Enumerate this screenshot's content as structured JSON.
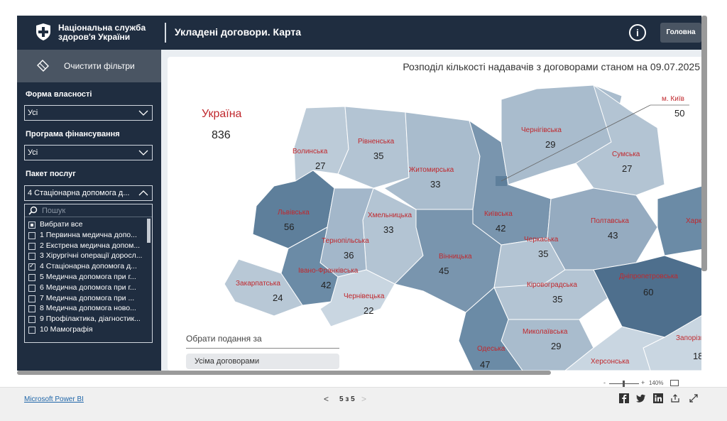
{
  "header": {
    "org_name_line1": "Національна служба",
    "org_name_line2": "здоров'я України",
    "title": "Укладені договори. Карта",
    "info_label": "i",
    "home_label": "Головна"
  },
  "sidebar": {
    "clear_filters": "Очистити фільтри",
    "ownership_label": "Форма власності",
    "ownership_value": "Усі",
    "program_label": "Програма фінансування",
    "program_value": "Усі",
    "package_label": "Пакет послуг",
    "package_value": "4 Стаціонарна допомога д...",
    "search_placeholder": "Пошук",
    "options": [
      {
        "label": "Вибрати все",
        "state": "partial"
      },
      {
        "label": "1 Первинна медична допо...",
        "state": "off"
      },
      {
        "label": "2 Екстрена медична допом...",
        "state": "off"
      },
      {
        "label": "3 Хірургічні операції доросл...",
        "state": "off"
      },
      {
        "label": "4 Стаціонарна допомога д...",
        "state": "on"
      },
      {
        "label": "5 Медична допомога при г...",
        "state": "off"
      },
      {
        "label": "6 Медична допомога при г...",
        "state": "off"
      },
      {
        "label": "7 Медична допомога при ...",
        "state": "off"
      },
      {
        "label": "8 Медична допомога ново...",
        "state": "off"
      },
      {
        "label": "9 Профілактика, діагностик...",
        "state": "off"
      },
      {
        "label": "10 Мамографія",
        "state": "off"
      }
    ]
  },
  "map": {
    "title": "Розподіл кількості надавачів з договорами станом на 09.07.2025",
    "country_label": "Україна",
    "country_value": "836",
    "kyiv_label": "м. Київ",
    "kyiv_value": "50",
    "regions": [
      {
        "name": "Волинська",
        "value": "27"
      },
      {
        "name": "Рівненська",
        "value": "35"
      },
      {
        "name": "Житомирська",
        "value": "33"
      },
      {
        "name": "Чернігівська",
        "value": "29"
      },
      {
        "name": "Сумська",
        "value": "27"
      },
      {
        "name": "Львівська",
        "value": "56"
      },
      {
        "name": "Хмельницька",
        "value": "33"
      },
      {
        "name": "Київська",
        "value": "42"
      },
      {
        "name": "Полтавська",
        "value": "43"
      },
      {
        "name": "Харк",
        "value": ""
      },
      {
        "name": "Тернопільська",
        "value": "36"
      },
      {
        "name": "Черкаська",
        "value": "35"
      },
      {
        "name": "Вінницька",
        "value": "45"
      },
      {
        "name": "Івано-Франківська",
        "value": "42"
      },
      {
        "name": "Закарпатська",
        "value": "24"
      },
      {
        "name": "Чернівецька",
        "value": "22"
      },
      {
        "name": "Кіровоградська",
        "value": "35"
      },
      {
        "name": "Дніпропетровська",
        "value": "60"
      },
      {
        "name": "Миколаївська",
        "value": "29"
      },
      {
        "name": "Одеська",
        "value": "47"
      },
      {
        "name": "Запорізька",
        "value": "18"
      },
      {
        "name": "Херсонська",
        "value": ""
      }
    ],
    "view_label": "Обрати подання за",
    "view_option": "Усіма договорами",
    "colors": {
      "light": "#c4d2de",
      "mid": "#9fb4c8",
      "dark": "#5d7d99",
      "darkest": "#4a6a88",
      "label": "#c0282d"
    }
  },
  "footer": {
    "powerbi_link": "Microsoft Power BI",
    "prev": "<",
    "page": "5 з 5",
    "next": ">",
    "zoom_minus": "-",
    "zoom_plus": "+",
    "zoom_level": "140%"
  }
}
